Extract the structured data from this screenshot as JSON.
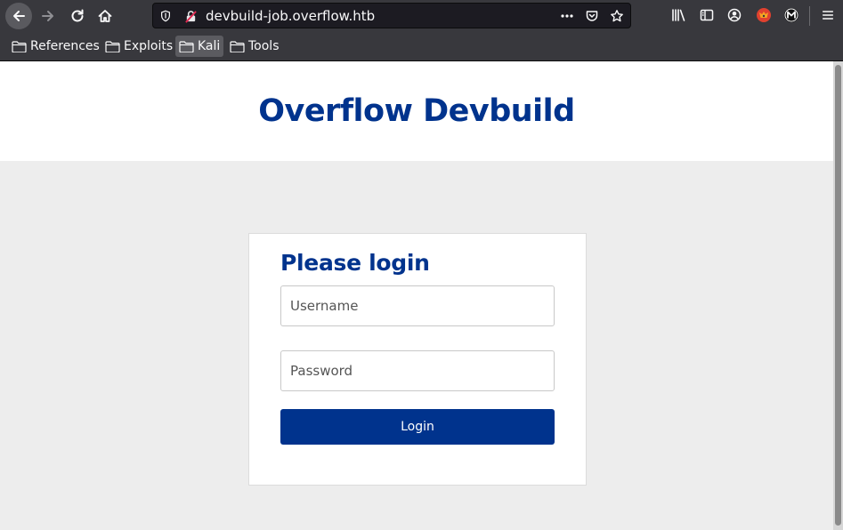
{
  "browser": {
    "url": "devbuild-job.overflow.htb",
    "bookmarks": [
      {
        "label": "References",
        "active": false
      },
      {
        "label": "Exploits",
        "active": false
      },
      {
        "label": "Kali",
        "active": true
      },
      {
        "label": "Tools",
        "active": false
      }
    ],
    "icons": [
      "back-icon",
      "forward-icon",
      "reload-icon",
      "home-icon",
      "shield-icon",
      "insecure-lock-icon",
      "more-icon",
      "pocket-icon",
      "star-icon",
      "library-icon",
      "sidebar-icon",
      "account-icon",
      "foxyproxy-icon",
      "extension-m-icon",
      "menu-icon"
    ]
  },
  "page": {
    "site_title": "Overflow Devbuild",
    "login": {
      "heading": "Please login",
      "username_placeholder": "Username",
      "password_placeholder": "Password",
      "button_label": "Login"
    }
  },
  "colors": {
    "brand": "#00338d",
    "chrome": "#38383d",
    "urlbar": "#1c1b22",
    "page_bg": "#ededed"
  }
}
